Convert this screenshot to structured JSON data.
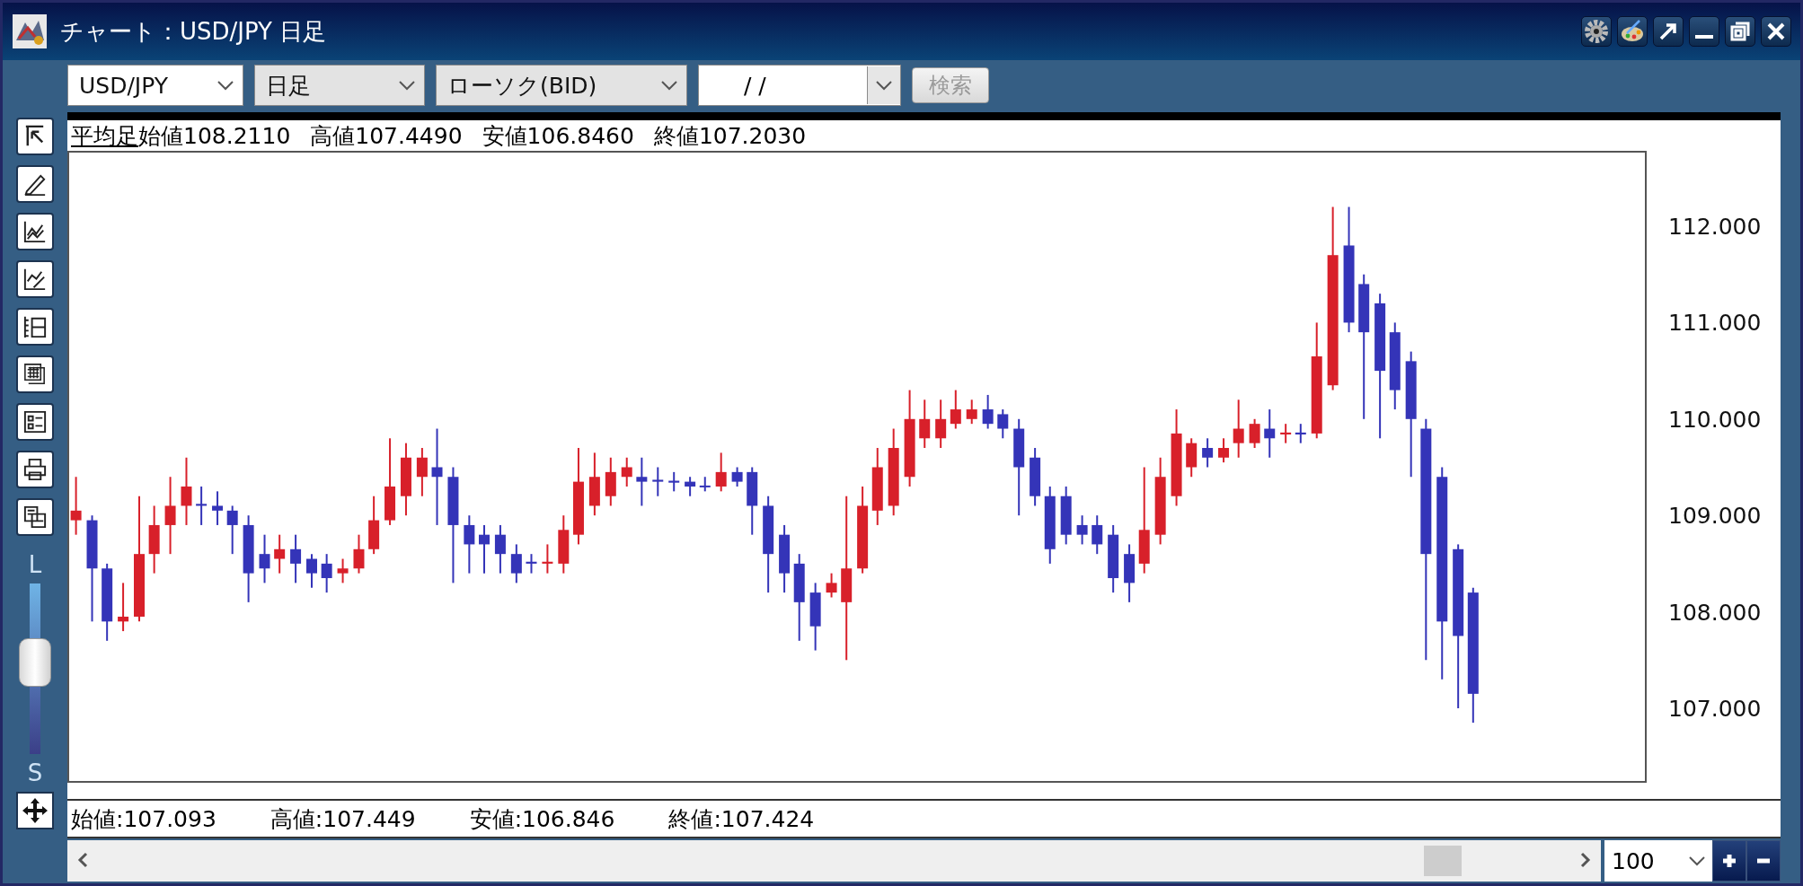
{
  "window": {
    "title": "チャート：USD/JPY 日足"
  },
  "toolbar": {
    "symbol": "USD/JPY",
    "period": "日足",
    "chart_type": "ローソク(BID)",
    "date": "/ /",
    "search_button": {
      "label": "検索",
      "disabled": true
    }
  },
  "chart_header": {
    "mode_link": "平均足",
    "values": [
      "始値108.2110",
      "高値107.4490",
      "安値106.8460",
      "終値107.2030"
    ]
  },
  "price_labels": [
    "112.000",
    "111.000",
    "110.000",
    "109.000",
    "108.000",
    "107.000"
  ],
  "zoom_slider": {
    "top_label": "L",
    "bottom_label": "S",
    "level": 0.55
  },
  "ohlc_bar": [
    "始値:107.093",
    "高値:107.449",
    "安値:106.846",
    "終値:107.424"
  ],
  "zoom_select": {
    "value": "100"
  }
}
